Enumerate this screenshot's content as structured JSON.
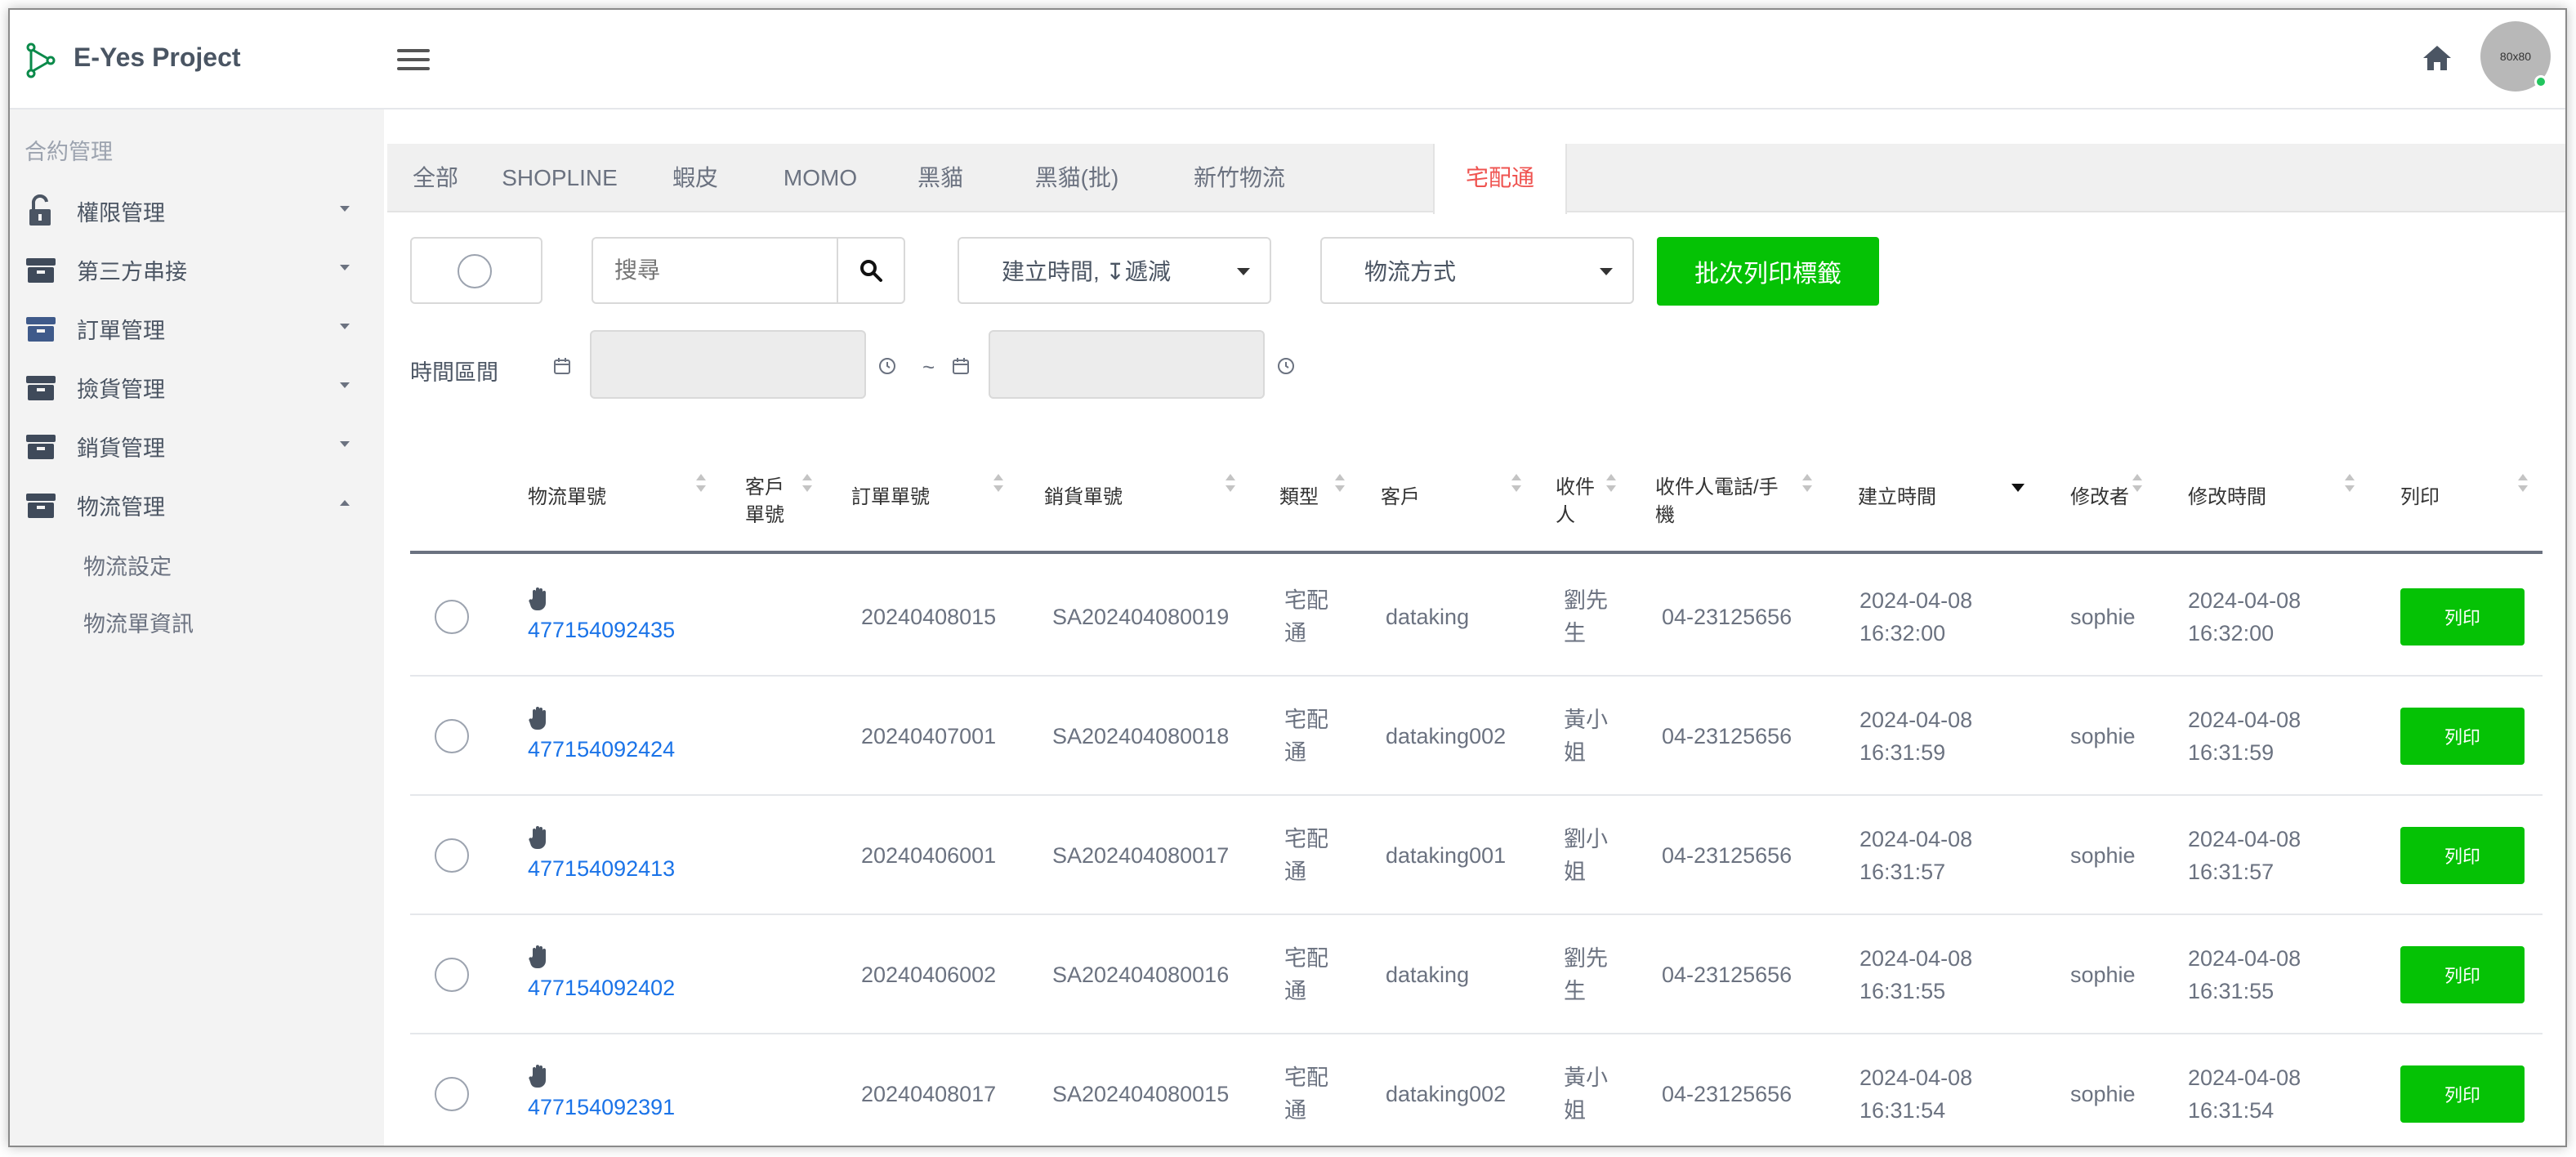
{
  "app": {
    "title": "E-Yes Project",
    "avatar_text": "80x80"
  },
  "sidebar": {
    "section_title": "合約管理",
    "items": [
      {
        "label": "權限管理",
        "icon": "lock-icon"
      },
      {
        "label": "第三方串接",
        "icon": "box-icon"
      },
      {
        "label": "訂單管理",
        "icon": "box-icon"
      },
      {
        "label": "撿貨管理",
        "icon": "box-icon"
      },
      {
        "label": "銷貨管理",
        "icon": "box-icon"
      },
      {
        "label": "物流管理",
        "icon": "box-icon"
      }
    ],
    "sub_items": [
      {
        "label": "物流設定"
      },
      {
        "label": "物流單資訊"
      }
    ]
  },
  "tabs": [
    {
      "label": "全部"
    },
    {
      "label": "SHOPLINE"
    },
    {
      "label": "蝦皮"
    },
    {
      "label": "MOMO"
    },
    {
      "label": "黑貓"
    },
    {
      "label": "黑貓(批)"
    },
    {
      "label": "新竹物流"
    },
    {
      "label": "宅配通",
      "active": true
    }
  ],
  "filters": {
    "search_placeholder": "搜尋",
    "sort_label": "建立時間, ↧遞減",
    "shipping_method_label": "物流方式",
    "batch_print_label": "批次列印標籤",
    "time_range_label": "時間區間",
    "tilde": "~"
  },
  "table": {
    "headers": {
      "ship_no": "物流單號",
      "cust_no_line1": "客戶",
      "cust_no_line2": "單號",
      "order_no": "訂單單號",
      "sale_no": "銷貨單號",
      "type": "類型",
      "customer": "客戶",
      "recipient_line1": "收件",
      "recipient_line2": "人",
      "phone_line1": "收件人電話/手",
      "phone_line2": "機",
      "created": "建立時間",
      "modifier": "修改者",
      "modified": "修改時間",
      "print": "列印"
    },
    "rows": [
      {
        "ship_no": "477154092435",
        "order_no": "20240408015",
        "sale_no": "SA202404080019",
        "type1": "宅配",
        "type2": "通",
        "customer": "dataking",
        "rec1": "劉先",
        "rec2": "生",
        "phone": "04-23125656",
        "c_date": "2024-04-08",
        "c_time": "16:32:00",
        "modifier": "sophie",
        "m_date": "2024-04-08",
        "m_time": "16:32:00",
        "print": "列印"
      },
      {
        "ship_no": "477154092424",
        "order_no": "20240407001",
        "sale_no": "SA202404080018",
        "type1": "宅配",
        "type2": "通",
        "customer": "dataking002",
        "rec1": "黃小",
        "rec2": "姐",
        "phone": "04-23125656",
        "c_date": "2024-04-08",
        "c_time": "16:31:59",
        "modifier": "sophie",
        "m_date": "2024-04-08",
        "m_time": "16:31:59",
        "print": "列印"
      },
      {
        "ship_no": "477154092413",
        "order_no": "20240406001",
        "sale_no": "SA202404080017",
        "type1": "宅配",
        "type2": "通",
        "customer": "dataking001",
        "rec1": "劉小",
        "rec2": "姐",
        "phone": "04-23125656",
        "c_date": "2024-04-08",
        "c_time": "16:31:57",
        "modifier": "sophie",
        "m_date": "2024-04-08",
        "m_time": "16:31:57",
        "print": "列印"
      },
      {
        "ship_no": "477154092402",
        "order_no": "20240406002",
        "sale_no": "SA202404080016",
        "type1": "宅配",
        "type2": "通",
        "customer": "dataking",
        "rec1": "劉先",
        "rec2": "生",
        "phone": "04-23125656",
        "c_date": "2024-04-08",
        "c_time": "16:31:55",
        "modifier": "sophie",
        "m_date": "2024-04-08",
        "m_time": "16:31:55",
        "print": "列印"
      },
      {
        "ship_no": "477154092391",
        "order_no": "20240408017",
        "sale_no": "SA202404080015",
        "type1": "宅配",
        "type2": "通",
        "customer": "dataking002",
        "rec1": "黃小",
        "rec2": "姐",
        "phone": "04-23125656",
        "c_date": "2024-04-08",
        "c_time": "16:31:54",
        "modifier": "sophie",
        "m_date": "2024-04-08",
        "m_time": "16:31:54",
        "print": "列印"
      }
    ]
  },
  "colors": {
    "accent_green": "#05c205",
    "active_tab": "#ef5350",
    "link": "#1a73e8"
  }
}
